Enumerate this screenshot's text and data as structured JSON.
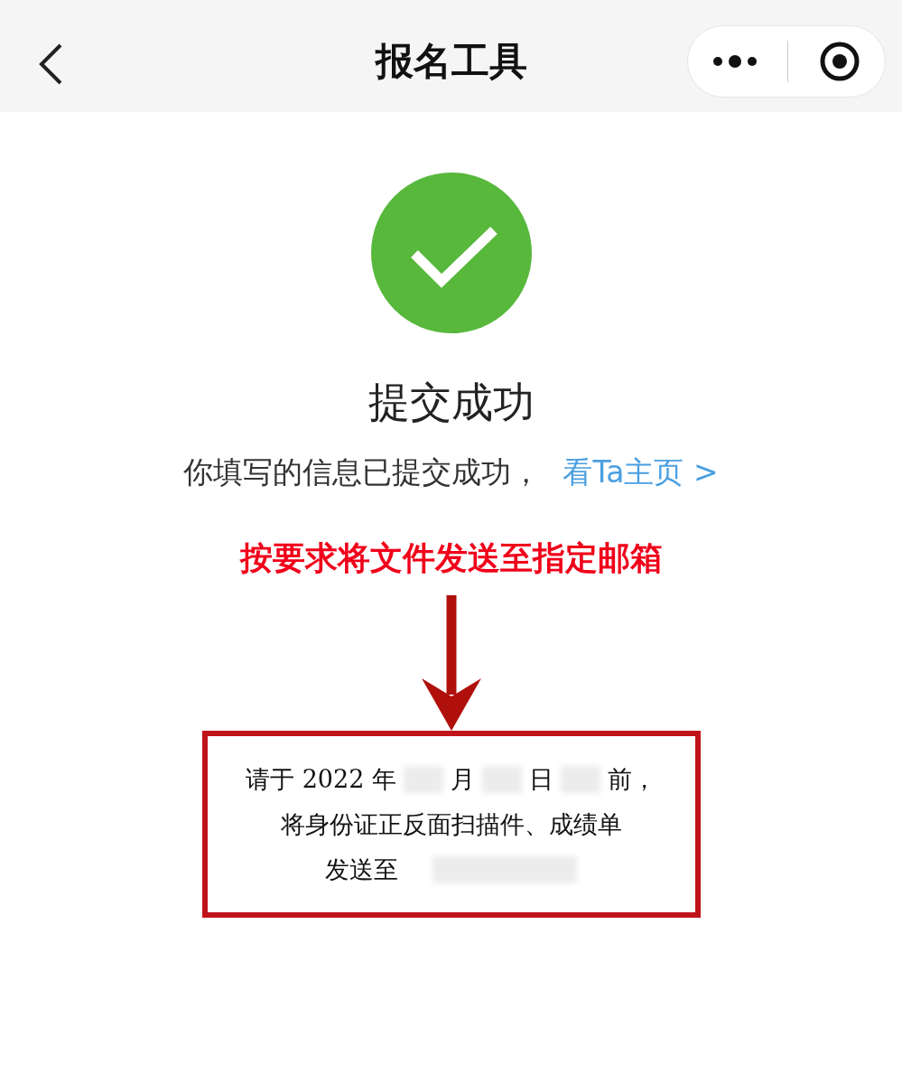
{
  "nav_bar": {
    "title": "报名工具"
  },
  "result": {
    "title": "提交成功",
    "message": "你填写的信息已提交成功，",
    "link": "看Ta主页 >"
  },
  "annotation": {
    "caption": "按要求将文件发送至指定邮箱"
  },
  "notice": {
    "lines": [
      {
        "parts": [
          {
            "kind": "text",
            "text": "请于 2022 年"
          },
          {
            "kind": "redacted"
          },
          {
            "kind": "text",
            "text": "月"
          },
          {
            "kind": "redacted"
          },
          {
            "kind": "text",
            "text": "日"
          },
          {
            "kind": "redacted"
          },
          {
            "kind": "text",
            "text": "前，"
          }
        ]
      },
      {
        "parts": [
          {
            "kind": "text",
            "text": "将身份证正反面扫描件、成绩单"
          }
        ]
      },
      {
        "parts": [
          {
            "kind": "text",
            "text": "发送至"
          },
          {
            "kind": "redacted"
          }
        ]
      }
    ]
  }
}
